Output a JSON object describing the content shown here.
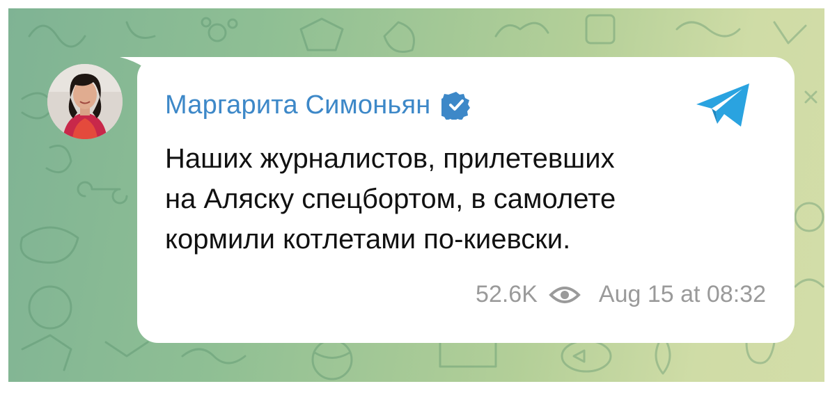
{
  "post": {
    "sender_name": "Маргарита Симоньян",
    "verified_icon": "verified-badge-icon",
    "app_icon": "telegram-icon",
    "message_lines": [
      "Наших журналистов, прилетевших",
      "на Аляску спецбортом, в самолете",
      "кормили котлетами по-киевски."
    ],
    "views": "52.6K",
    "views_icon": "eye-icon",
    "timestamp": "Aug 15 at 08:32"
  },
  "colors": {
    "sender_blue": "#3d88c8",
    "telegram_blue": "#2aa3e0",
    "meta_gray": "#9a9a9a",
    "background_green": "#8fbf94"
  }
}
